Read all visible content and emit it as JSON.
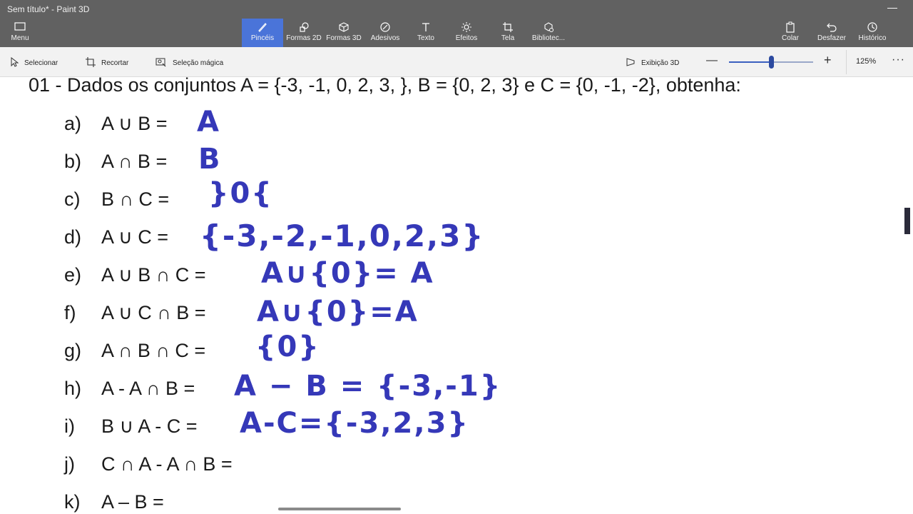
{
  "window": {
    "title": "Sem título* - Paint 3D"
  },
  "ribbon": {
    "menu": "Menu",
    "pinceis": "Pincéis",
    "formas2d": "Formas 2D",
    "formas3d": "Formas 3D",
    "adesivos": "Adesivos",
    "texto": "Texto",
    "efeitos": "Efeitos",
    "tela": "Tela",
    "biblioteca": "Bibliotec...",
    "colar": "Colar",
    "desfazer": "Desfazer",
    "historico": "Histórico",
    "active_tab": "Pincéis",
    "accent": "#4a74d9"
  },
  "toolbar": {
    "selecionar": "Selecionar",
    "recortar": "Recortar",
    "selecao_magica": "Seleção mágica",
    "exibicao_3d": "Exibição 3D",
    "zoom_value": "125%",
    "zoom_level": 0.5
  },
  "document": {
    "heading": "01 - Dados os conjuntos A = {-3, -1, 0, 2, 3, }, B = {0, 2, 3} e C = {0, -1, -2}, obtenha:",
    "items": [
      {
        "letter": "a)",
        "expr": "A ∪ B =",
        "answer": "A"
      },
      {
        "letter": "b)",
        "expr": "A ∩ B =",
        "answer": "B"
      },
      {
        "letter": "c)",
        "expr": "B ∩ C =",
        "answer": "}0{"
      },
      {
        "letter": "d)",
        "expr": "A ∪ C =",
        "answer": "{-3,-2,-1,0,2,3}"
      },
      {
        "letter": "e)",
        "expr": "A ∪ B ∩ C =",
        "answer": "A∪{0}= A"
      },
      {
        "letter": "f)",
        "expr": "A ∪ C ∩ B =",
        "answer": "A∪{0}=A"
      },
      {
        "letter": "g)",
        "expr": "A ∩ B ∩ C =",
        "answer": "{0}"
      },
      {
        "letter": "h)",
        "expr": "A - A ∩ B =",
        "answer": "A − B = {-3,-1}"
      },
      {
        "letter": "i)",
        "expr": "B ∪ A - C =",
        "answer": "A-C={-3,2,3}"
      },
      {
        "letter": "j)",
        "expr": "C ∩ A - A ∩ B =",
        "answer": ""
      },
      {
        "letter": "k)",
        "expr": "A – B =",
        "answer": ""
      }
    ],
    "ink_color": "#3538b8"
  }
}
